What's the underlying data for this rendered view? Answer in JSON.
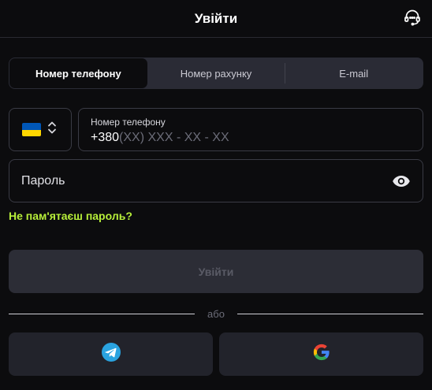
{
  "header": {
    "title": "Увійти",
    "support_icon": "headset-icon"
  },
  "tabs": [
    {
      "label": "Номер телефону",
      "active": true
    },
    {
      "label": "Номер рахунку",
      "active": false
    },
    {
      "label": "E-mail",
      "active": false
    }
  ],
  "country_selector": {
    "flag": "ukraine-flag-icon",
    "chevron": "chevron-up-down-icon",
    "flag_colors": [
      "#0057b7",
      "#ffd700"
    ]
  },
  "phone_field": {
    "label": "Номер телефону",
    "prefix": "+380",
    "mask": "(XX) XXX - XX - XX"
  },
  "password_field": {
    "placeholder": "Пароль",
    "toggle_icon": "eye-icon"
  },
  "forgot_password": "Не пам'ятаєш пароль?",
  "login_button": "Увійти",
  "divider_text": "або",
  "social": {
    "telegram_icon": "telegram-icon",
    "google_icon": "google-icon"
  },
  "colors": {
    "background": "#0c0c0e",
    "accent": "#b8f03a",
    "panel": "#2a2b35",
    "disabled_button": "#2c2d36"
  }
}
